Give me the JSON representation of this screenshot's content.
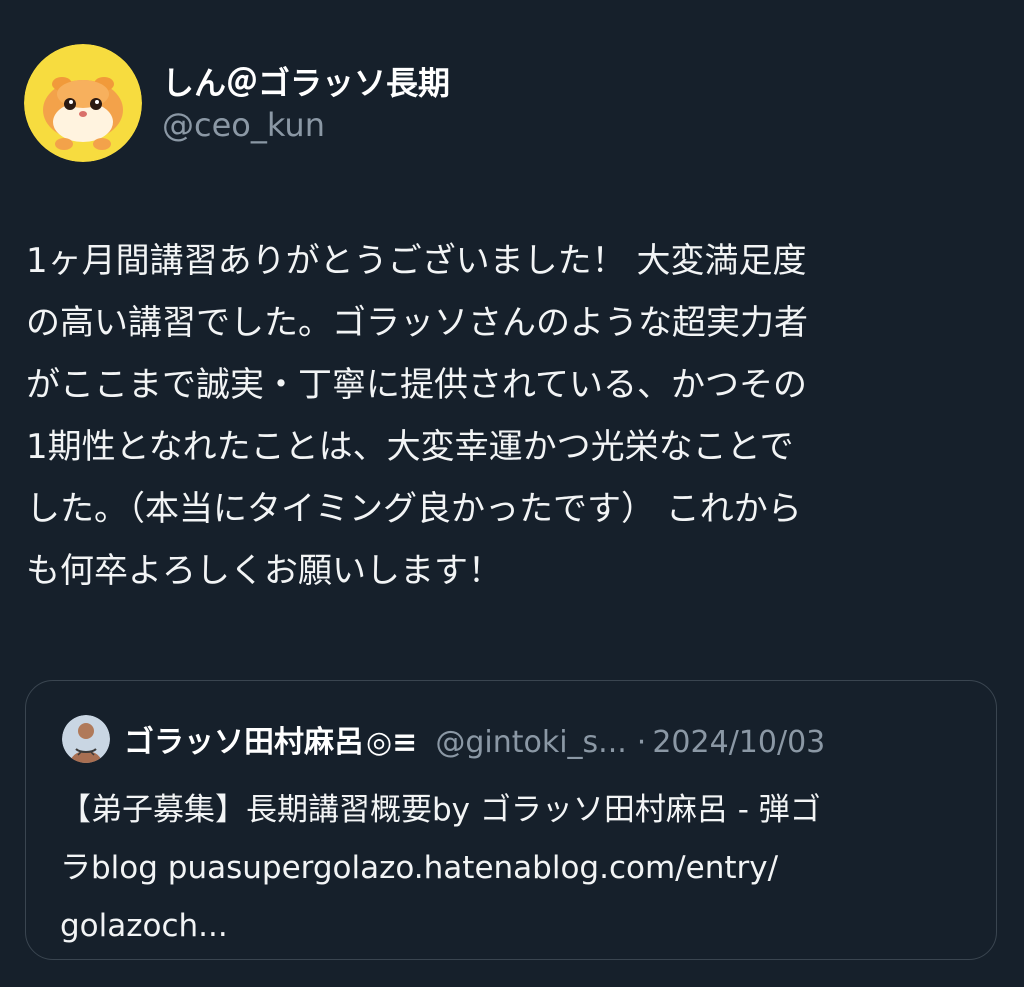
{
  "tweet": {
    "avatar_icon": "pui-pui-molcar-avatar-icon",
    "display_name": "しん＠ゴラッソ長期",
    "handle": "@ceo_kun",
    "text": "1ヶ月間講習ありがとうございました！ 大変満足度\nの高い講習でした。ゴラッソさんのような超実力者\nがここまで誠実・丁寧に提供されている、かつその\n1期性となれたことは、大変幸運かつ光栄なことで\nした。（本当にタイミング良かったです） これから\nも何卒よろしくお願いします！"
  },
  "quote": {
    "avatar_icon": "user-photo-avatar-icon",
    "display_name": "ゴラッソ田村麻呂",
    "name_symbol": "◎≡",
    "handle": "@gintoki_s...",
    "separator": "·",
    "date": "2024/10/03",
    "text": "【弟子募集】長期講習概要by ゴラッソ田村麻呂 - 弾ゴ\nラblog puasupergolazo.hatenablog.com/entry/\ngolazoch..."
  },
  "colors": {
    "background": "#16202b",
    "text": "#f2f4f5",
    "secondary_text": "#8b98a5",
    "card_border": "#3a4550"
  }
}
